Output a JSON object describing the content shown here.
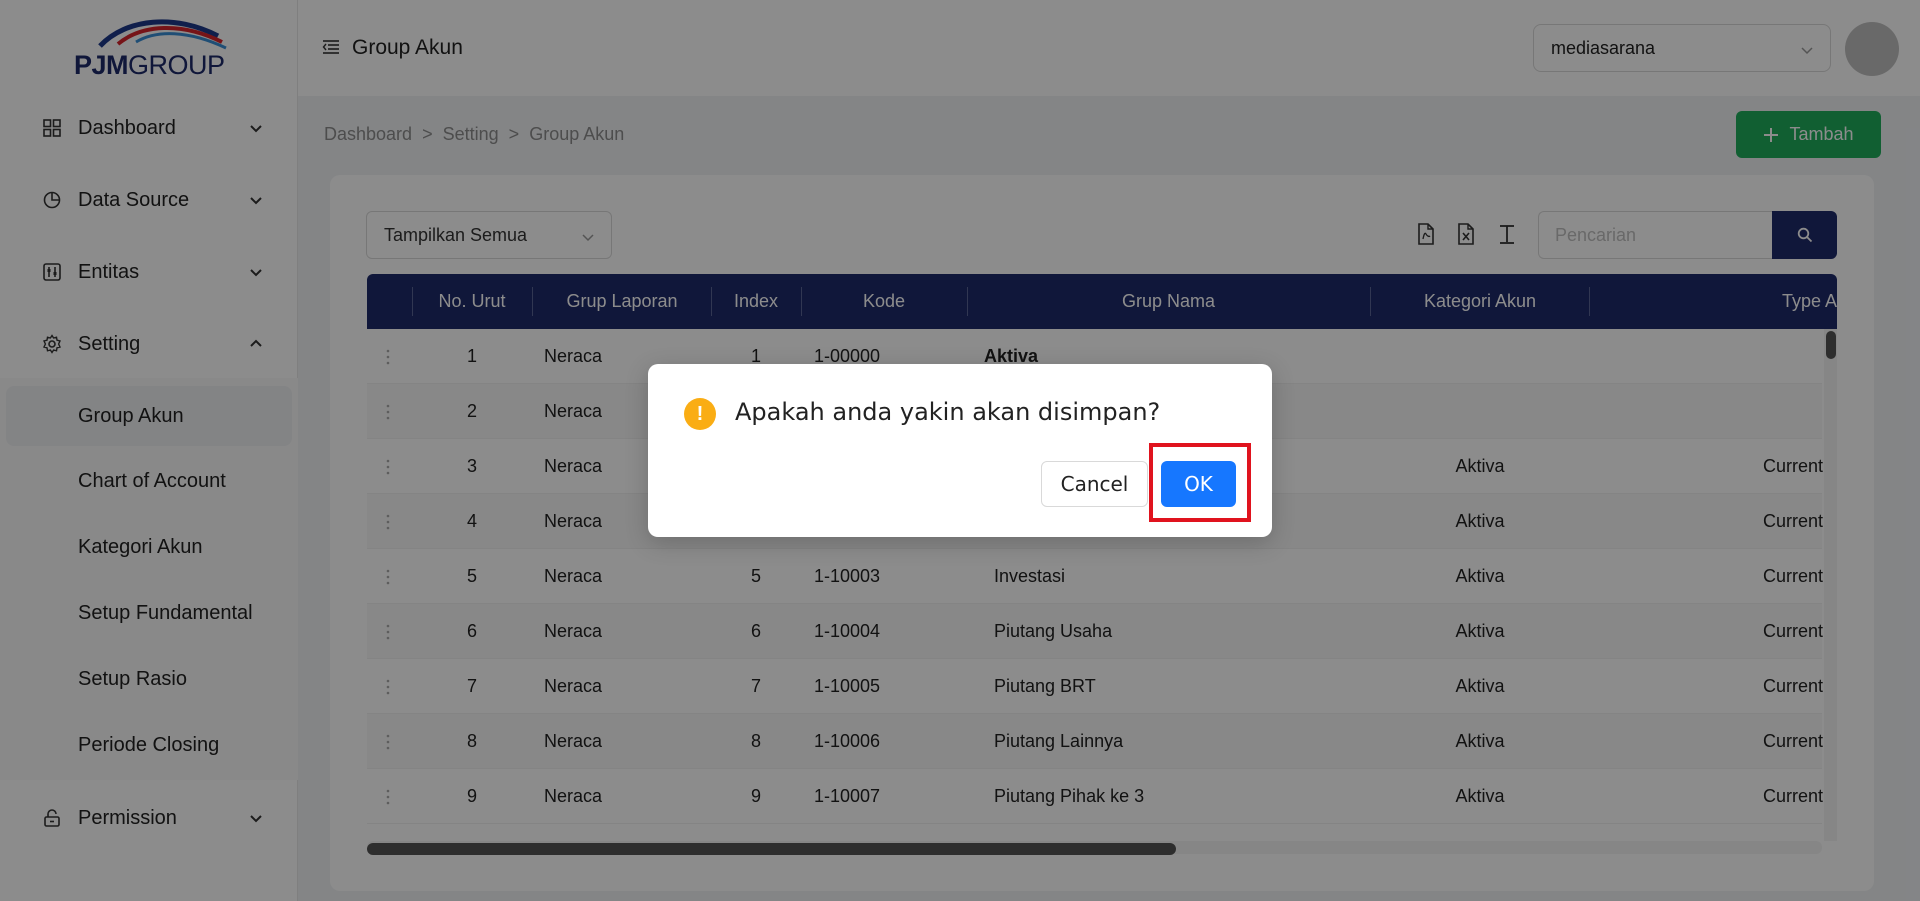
{
  "brand": {
    "logo_bold": "PJM",
    "logo_rest": "GROUP"
  },
  "sidebar": {
    "items": [
      {
        "label": "Dashboard",
        "icon": "dashboard-icon",
        "expanded": false
      },
      {
        "label": "Data Source",
        "icon": "pie-chart-icon",
        "expanded": false
      },
      {
        "label": "Entitas",
        "icon": "sliders-icon",
        "expanded": false
      },
      {
        "label": "Setting",
        "icon": "gear-icon",
        "expanded": true
      },
      {
        "label": "Permission",
        "icon": "lock-icon",
        "expanded": false
      }
    ],
    "setting_children": [
      {
        "label": "Group Akun",
        "active": true
      },
      {
        "label": "Chart of Account",
        "active": false
      },
      {
        "label": "Kategori Akun",
        "active": false
      },
      {
        "label": "Setup Fundamental",
        "active": false
      },
      {
        "label": "Setup Rasio",
        "active": false
      },
      {
        "label": "Periode Closing",
        "active": false
      }
    ]
  },
  "header": {
    "title": "Group Akun",
    "org_select": "mediasarana"
  },
  "breadcrumb": [
    "Dashboard",
    "Setting",
    "Group Akun"
  ],
  "breadcrumb_sep": ">",
  "add_button": "Tambah",
  "toolbar": {
    "filter_select": "Tampilkan Semua",
    "search_placeholder": "Pencarian",
    "tools": [
      "pdf-export-icon",
      "excel-export-icon",
      "text-export-icon"
    ]
  },
  "table": {
    "columns": [
      "No. Urut",
      "Grup Laporan",
      "Index",
      "Kode",
      "Grup Nama",
      "Kategori Akun",
      "Type A"
    ],
    "rows": [
      {
        "no": "1",
        "grup_laporan": "Neraca",
        "index": "1",
        "kode": "1-00000",
        "grup_nama": "Aktiva",
        "kategori": "",
        "type": ""
      },
      {
        "no": "2",
        "grup_laporan": "Neraca",
        "index": "",
        "kode": "",
        "grup_nama": "",
        "kategori": "",
        "type": ""
      },
      {
        "no": "3",
        "grup_laporan": "Neraca",
        "index": "",
        "kode": "",
        "grup_nama": "",
        "kategori": "Aktiva",
        "type": "Current"
      },
      {
        "no": "4",
        "grup_laporan": "Neraca",
        "index": "",
        "kode": "",
        "grup_nama": "",
        "kategori": "Aktiva",
        "type": "Current"
      },
      {
        "no": "5",
        "grup_laporan": "Neraca",
        "index": "5",
        "kode": "1-10003",
        "grup_nama": "Investasi",
        "kategori": "Aktiva",
        "type": "Current"
      },
      {
        "no": "6",
        "grup_laporan": "Neraca",
        "index": "6",
        "kode": "1-10004",
        "grup_nama": "Piutang Usaha",
        "kategori": "Aktiva",
        "type": "Current"
      },
      {
        "no": "7",
        "grup_laporan": "Neraca",
        "index": "7",
        "kode": "1-10005",
        "grup_nama": "Piutang BRT",
        "kategori": "Aktiva",
        "type": "Current"
      },
      {
        "no": "8",
        "grup_laporan": "Neraca",
        "index": "8",
        "kode": "1-10006",
        "grup_nama": "Piutang Lainnya",
        "kategori": "Aktiva",
        "type": "Current"
      },
      {
        "no": "9",
        "grup_laporan": "Neraca",
        "index": "9",
        "kode": "1-10007",
        "grup_nama": "Piutang Pihak ke 3",
        "kategori": "Aktiva",
        "type": "Current"
      }
    ]
  },
  "modal": {
    "message": "Apakah anda yakin akan disimpan?",
    "cancel": "Cancel",
    "ok": "OK",
    "icon": "warning-icon"
  },
  "colors": {
    "brand_navy": "#1e2a6b",
    "success": "#1fad5c",
    "primary": "#1677ff",
    "warning": "#faad14",
    "highlight": "#e0131e"
  }
}
